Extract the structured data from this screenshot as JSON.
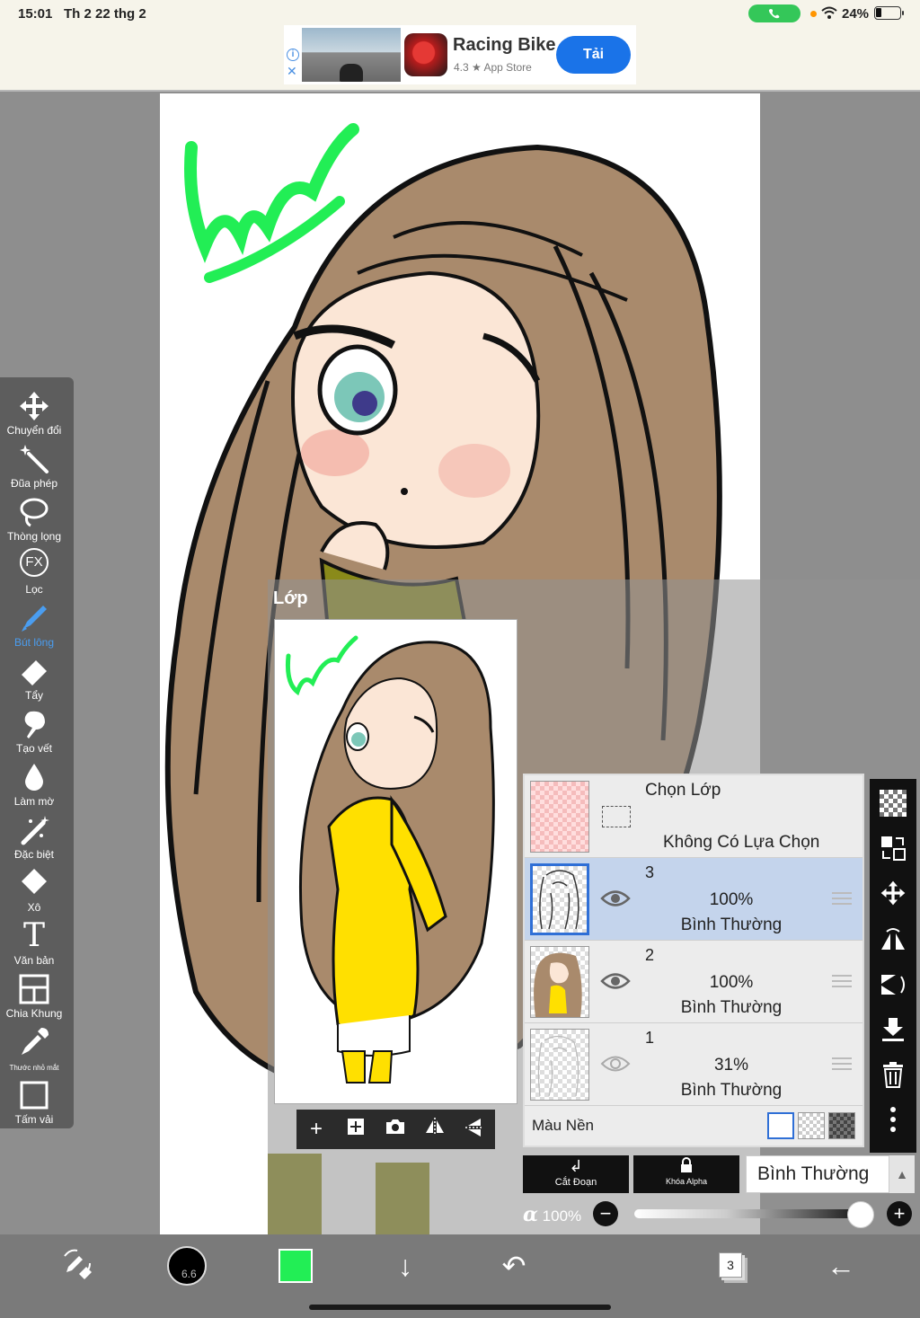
{
  "status_bar": {
    "time": "15:01",
    "date": "Th 2 22 thg 2",
    "battery": "24%"
  },
  "ad": {
    "title": "Racing Bike",
    "rating": "4.3 ★ App Store",
    "cta": "Tải",
    "info": "i",
    "close": "✕"
  },
  "toolbar": {
    "items": [
      {
        "label": "Chuyển đổi",
        "icon": "move-icon"
      },
      {
        "label": "Đũa phép",
        "icon": "magic-wand-icon"
      },
      {
        "label": "Thòng lọng",
        "icon": "lasso-icon"
      },
      {
        "label": "Lọc",
        "icon": "fx-filter-icon"
      },
      {
        "label": "Bút lông",
        "icon": "brush-icon",
        "active": true
      },
      {
        "label": "Tẩy",
        "icon": "eraser-icon"
      },
      {
        "label": "Tạo vết",
        "icon": "smudge-icon"
      },
      {
        "label": "Làm mờ",
        "icon": "blur-icon"
      },
      {
        "label": "Đặc biệt",
        "icon": "special-icon"
      },
      {
        "label": "Xô",
        "icon": "bucket-icon"
      },
      {
        "label": "Văn bản",
        "icon": "text-icon"
      },
      {
        "label": "Chia Khung",
        "icon": "frame-divider-icon"
      },
      {
        "label": "Thước nhỏ mắt",
        "icon": "eyedropper-icon"
      },
      {
        "label": "Tấm vải",
        "icon": "canvas-icon"
      }
    ],
    "fx_glyph": "FX",
    "text_glyph": "T"
  },
  "layer_panel": {
    "title": "Lớp",
    "selection": {
      "title": "Chọn Lớp",
      "subtitle": "Không Có Lựa Chọn"
    },
    "layers": [
      {
        "number": "3",
        "opacity": "100%",
        "mode": "Bình Thường",
        "selected": true
      },
      {
        "number": "2",
        "opacity": "100%",
        "mode": "Bình Thường",
        "selected": false
      },
      {
        "number": "1",
        "opacity": "31%",
        "mode": "Bình Thường",
        "selected": false
      }
    ],
    "background_label": "Màu Nền",
    "clip_label": "Cắt Đoạn",
    "alpha_lock_label": "Khóa Alpha",
    "blend_mode": "Bình Thường",
    "alpha_symbol": "α",
    "alpha_value": "100%",
    "alpha_fraction": 1.0
  },
  "bottom_bar": {
    "brush_size": "6.6",
    "layer_count": "3",
    "primary_color": "#22ee55"
  },
  "colors": {
    "accent": "#2f6fd6",
    "active_tool": "#4a9df0",
    "ad_button": "#1a73e8"
  }
}
